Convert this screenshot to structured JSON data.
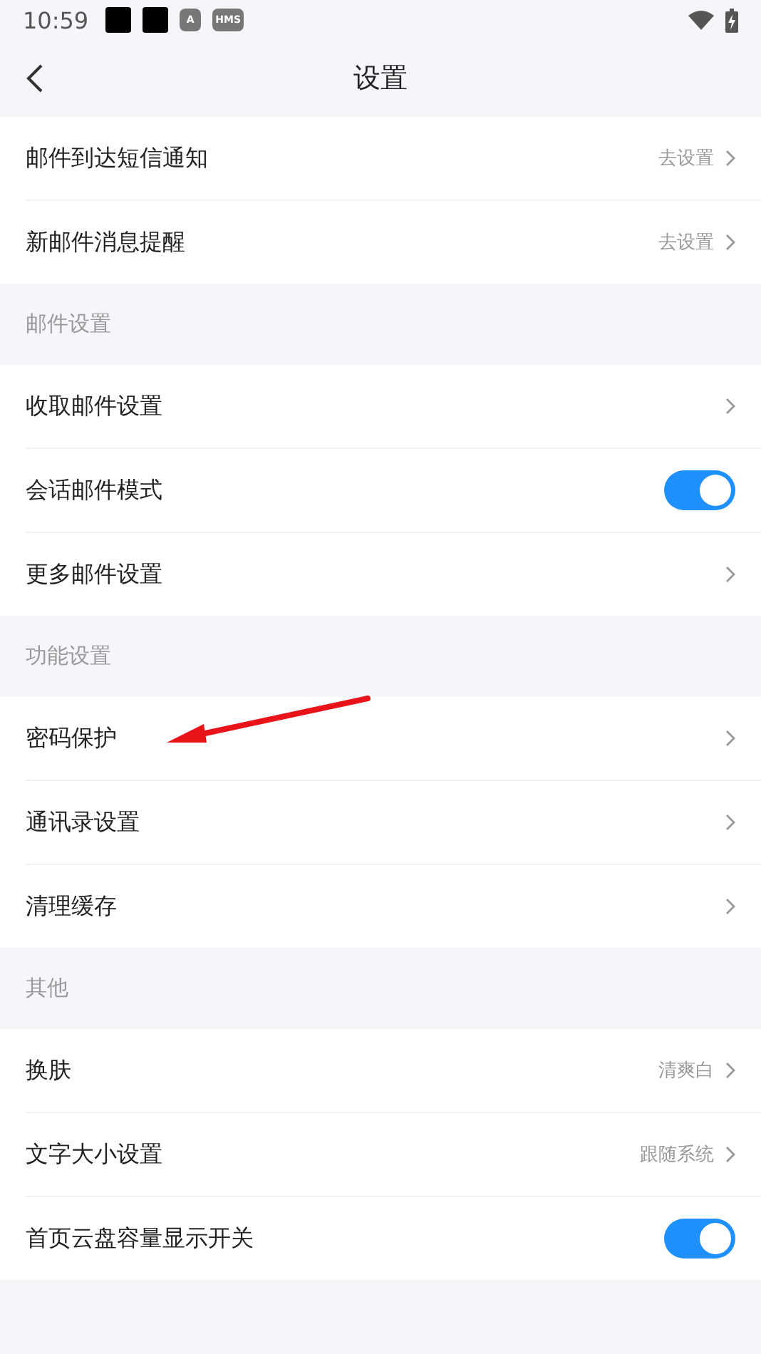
{
  "status_bar": {
    "time": "10:59",
    "notifications": [
      {
        "kind": "block"
      },
      {
        "kind": "block"
      },
      {
        "kind": "badge",
        "label": "A"
      },
      {
        "kind": "badge",
        "label": "HMS"
      }
    ]
  },
  "header": {
    "title": "设置"
  },
  "sections": [
    {
      "items": [
        {
          "kind": "link",
          "label": "邮件到达短信通知",
          "value": "去设置"
        },
        {
          "kind": "link",
          "label": "新邮件消息提醒",
          "value": "去设置"
        }
      ]
    },
    {
      "title": "邮件设置",
      "items": [
        {
          "kind": "link",
          "label": "收取邮件设置"
        },
        {
          "kind": "toggle",
          "label": "会话邮件模式",
          "on": true
        },
        {
          "kind": "link",
          "label": "更多邮件设置"
        }
      ]
    },
    {
      "title": "功能设置",
      "items": [
        {
          "kind": "link",
          "label": "密码保护"
        },
        {
          "kind": "link",
          "label": "通讯录设置"
        },
        {
          "kind": "link",
          "label": "清理缓存"
        }
      ]
    },
    {
      "title": "其他",
      "items": [
        {
          "kind": "link",
          "label": "换肤",
          "value": "清爽白"
        },
        {
          "kind": "link",
          "label": "文字大小设置",
          "value": "跟随系统"
        },
        {
          "kind": "toggle",
          "label": "首页云盘容量显示开关",
          "on": true
        }
      ]
    }
  ]
}
